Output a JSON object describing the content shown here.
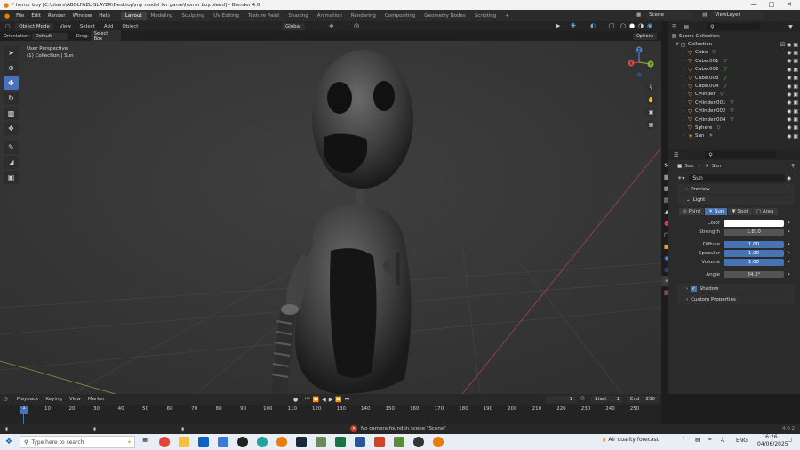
{
  "window": {
    "title": "* horror boy [C:\\Users\\ABOLFAZL-SLAYER\\Desktop\\my model for game\\horror boy.blend] - Blender 4.0",
    "controls": [
      "—",
      "□",
      "✕"
    ]
  },
  "menu": {
    "items": [
      "File",
      "Edit",
      "Render",
      "Window",
      "Help"
    ],
    "workspaces": [
      "Layout",
      "Modeling",
      "Sculpting",
      "UV Editing",
      "Texture Paint",
      "Shading",
      "Animation",
      "Rendering",
      "Compositing",
      "Geometry Nodes",
      "Scripting"
    ],
    "active_workspace": "Layout",
    "add_tab": "+",
    "scene": "Scene",
    "view_layer": "ViewLayer"
  },
  "viewport_header": {
    "mode": "Object Mode",
    "menus": [
      "View",
      "Select",
      "Add",
      "Object"
    ],
    "transform": "Global",
    "options": "Options"
  },
  "viewport_header2": {
    "orientation_label": "Orientation:",
    "orientation_value": "Default",
    "drag_label": "Drag:",
    "drag_value": "Select Box"
  },
  "viewport": {
    "perspective": "User Perspective",
    "context": "(1) Collection | Sun",
    "gizmo": {
      "x": "X",
      "y": "Y",
      "z": "Z"
    }
  },
  "outliner": {
    "search_placeholder": "",
    "root": "Scene Collection",
    "collection": "Collection",
    "items": [
      {
        "name": "Cube",
        "type": "mesh"
      },
      {
        "name": "Cube.001",
        "type": "mesh"
      },
      {
        "name": "Cube.002",
        "type": "mesh"
      },
      {
        "name": "Cube.003",
        "type": "mesh"
      },
      {
        "name": "Cube.004",
        "type": "mesh"
      },
      {
        "name": "Cylinder",
        "type": "mesh"
      },
      {
        "name": "Cylinder.001",
        "type": "mesh"
      },
      {
        "name": "Cylinder.002",
        "type": "mesh"
      },
      {
        "name": "Cylinder.004",
        "type": "mesh"
      },
      {
        "name": "Sphere",
        "type": "mesh"
      },
      {
        "name": "Sun",
        "type": "light"
      }
    ]
  },
  "properties": {
    "breadcrumb_object": "Sun",
    "breadcrumb_data": "Sun",
    "datablock": "Sun",
    "preview_label": "Preview",
    "light_label": "Light",
    "light_types": [
      "Point",
      "Sun",
      "Spot",
      "Area"
    ],
    "active_light_type": "Sun",
    "color_label": "Color",
    "strength_label": "Strength",
    "strength_value": "1.810",
    "diffuse_label": "Diffuse",
    "diffuse_value": "1.00",
    "specular_label": "Specular",
    "specular_value": "1.00",
    "volume_label": "Volume",
    "volume_value": "1.00",
    "angle_label": "Angle",
    "angle_value": "34.3°",
    "shadow_label": "Shadow",
    "custom_props_label": "Custom Properties"
  },
  "timeline": {
    "menus": [
      "Playback",
      "Keying",
      "View",
      "Marker"
    ],
    "current_frame": "1",
    "start_label": "Start",
    "start_value": "1",
    "end_label": "End",
    "end_value": "250",
    "ruler": [
      "0",
      "10",
      "20",
      "30",
      "40",
      "50",
      "60",
      "70",
      "80",
      "90",
      "100",
      "110",
      "120",
      "130",
      "140",
      "150",
      "160",
      "170",
      "180",
      "190",
      "200",
      "210",
      "220",
      "230",
      "240",
      "250"
    ],
    "playhead": "1"
  },
  "status": {
    "message": "No camera found in scene \"Scene\"",
    "version": "4.0.2"
  },
  "taskbar": {
    "search_placeholder": "Type here to search",
    "weather": "Air quality forecast",
    "lang": "ENG",
    "time": "16:26",
    "date": "04/06/2025"
  }
}
